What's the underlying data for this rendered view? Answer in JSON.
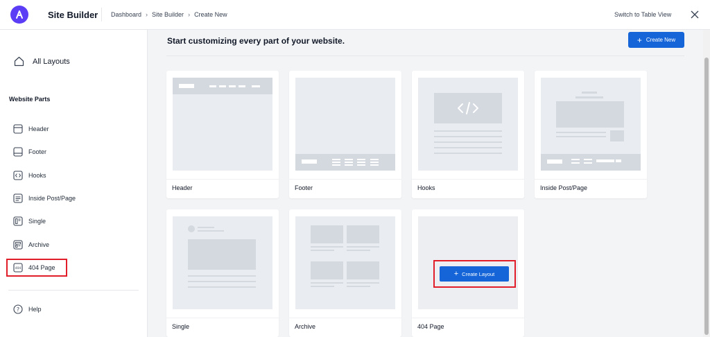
{
  "header": {
    "app_title": "Site Builder",
    "breadcrumb": [
      "Dashboard",
      "Site Builder",
      "Create New"
    ],
    "table_view_label": "Switch to Table View"
  },
  "sidebar": {
    "all_layouts": "All Layouts",
    "section_heading": "Website Parts",
    "items": [
      {
        "label": "Header",
        "icon": "header-icon"
      },
      {
        "label": "Footer",
        "icon": "footer-icon"
      },
      {
        "label": "Hooks",
        "icon": "code-icon"
      },
      {
        "label": "Inside Post/Page",
        "icon": "inside-post-icon"
      },
      {
        "label": "Single",
        "icon": "single-icon"
      },
      {
        "label": "Archive",
        "icon": "archive-icon"
      },
      {
        "label": "404 Page",
        "icon": "404-icon"
      }
    ],
    "help": "Help"
  },
  "main": {
    "heading": "Start customizing every part of your website.",
    "create_new_label": "Create New",
    "cards": [
      {
        "label": "Header"
      },
      {
        "label": "Footer"
      },
      {
        "label": "Hooks"
      },
      {
        "label": "Inside Post/Page"
      },
      {
        "label": "Single"
      },
      {
        "label": "Archive"
      },
      {
        "label": "404 Page",
        "create_layout_label": "Create Layout"
      }
    ]
  },
  "colors": {
    "brand": "#5b3df6",
    "primary_button": "#1565d8",
    "highlight": "#e11d2a"
  }
}
